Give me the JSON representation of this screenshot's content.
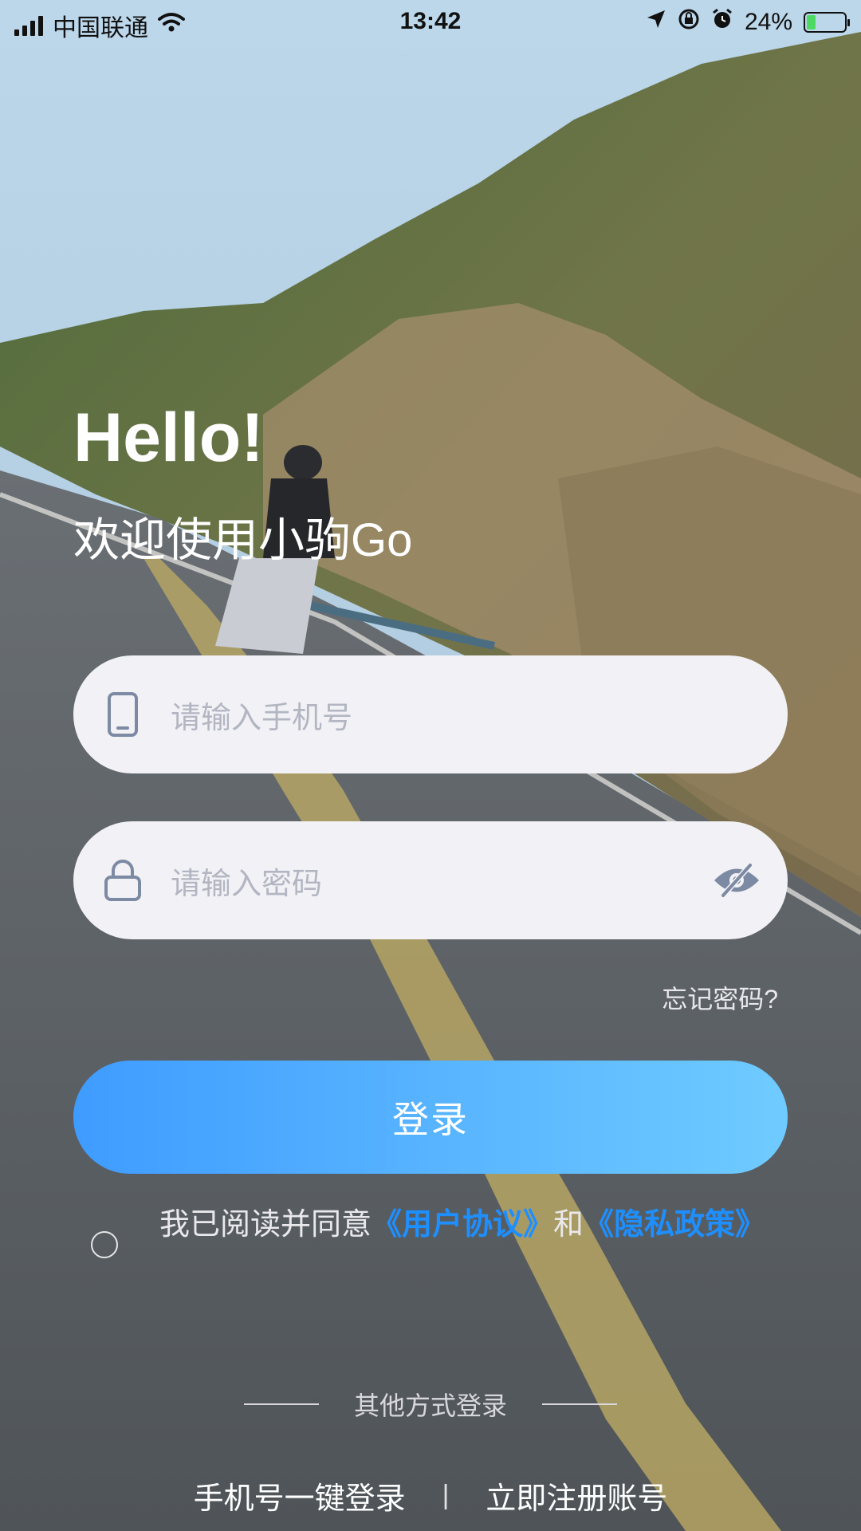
{
  "status_bar": {
    "carrier": "中国联通",
    "time": "13:42",
    "battery_percent": "24%",
    "battery_level": 0.24,
    "icons": [
      "signal-icon",
      "wifi-icon",
      "location-arrow-icon",
      "rotation-lock-icon",
      "alarm-icon",
      "battery-charging-icon"
    ]
  },
  "greeting": {
    "title": "Hello!",
    "subtitle": "欢迎使用小驹Go"
  },
  "form": {
    "phone_placeholder": "请输入手机号",
    "password_placeholder": "请输入密码",
    "forgot_password": "忘记密码?",
    "login_label": "登录",
    "login_gradient": [
      "#3f9cff",
      "#6fcbff"
    ]
  },
  "agreement": {
    "prefix": "我已阅读并同意",
    "user_agreement": "《用户协议》",
    "conjunction": "和",
    "privacy_policy": "《隐私政策》",
    "checked": false,
    "link_color": "#1e8fff"
  },
  "other_login": {
    "divider_label": "其他方式登录",
    "one_click_login": "手机号一键登录",
    "separator": "|",
    "register": "立即注册账号"
  }
}
